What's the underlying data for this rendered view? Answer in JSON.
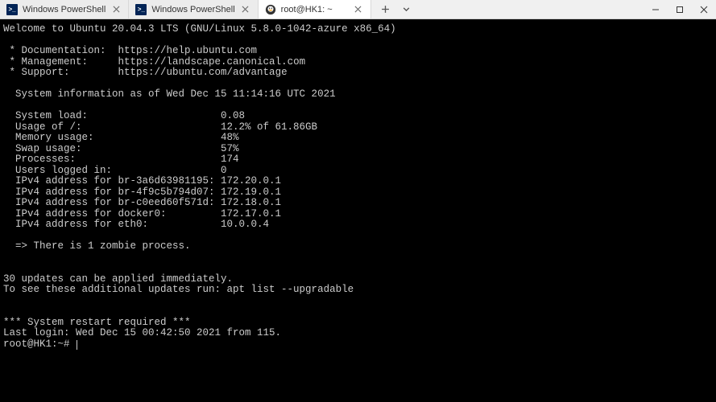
{
  "tabs": [
    {
      "label": "Windows PowerShell",
      "type": "powershell",
      "active": false
    },
    {
      "label": "Windows PowerShell",
      "type": "powershell",
      "active": false
    },
    {
      "label": "root@HK1: ~",
      "type": "linux",
      "active": true
    }
  ],
  "terminal": {
    "welcome": "Welcome to Ubuntu 20.04.3 LTS (GNU/Linux 5.8.0-1042-azure x86_64)",
    "links": {
      "doc_label": " * Documentation:  ",
      "doc_url": "https://help.ubuntu.com",
      "mgmt_label": " * Management:     ",
      "mgmt_url": "https://landscape.canonical.com",
      "sup_label": " * Support:        ",
      "sup_url": "https://ubuntu.com/advantage"
    },
    "sysinfo_header": "  System information as of Wed Dec 15 11:14:16 UTC 2021",
    "stats": [
      "  System load:                      0.08",
      "  Usage of /:                       12.2% of 61.86GB",
      "  Memory usage:                     48%",
      "  Swap usage:                       57%",
      "  Processes:                        174",
      "  Users logged in:                  0",
      "  IPv4 address for br-3a6d63981195: 172.20.0.1",
      "  IPv4 address for br-4f9c5b794d07: 172.19.0.1",
      "  IPv4 address for br-c0eed60f571d: 172.18.0.1",
      "  IPv4 address for docker0:         172.17.0.1",
      "  IPv4 address for eth0:            10.0.0.4"
    ],
    "zombie": "  => There is 1 zombie process.",
    "updates1": "30 updates can be applied immediately.",
    "updates2": "To see these additional updates run: apt list --upgradable",
    "restart": "*** System restart required ***",
    "lastlogin_prefix": "Last login: Wed Dec 15 00:42:50 2021 from 115.",
    "prompt": "root@HK1:~# "
  }
}
